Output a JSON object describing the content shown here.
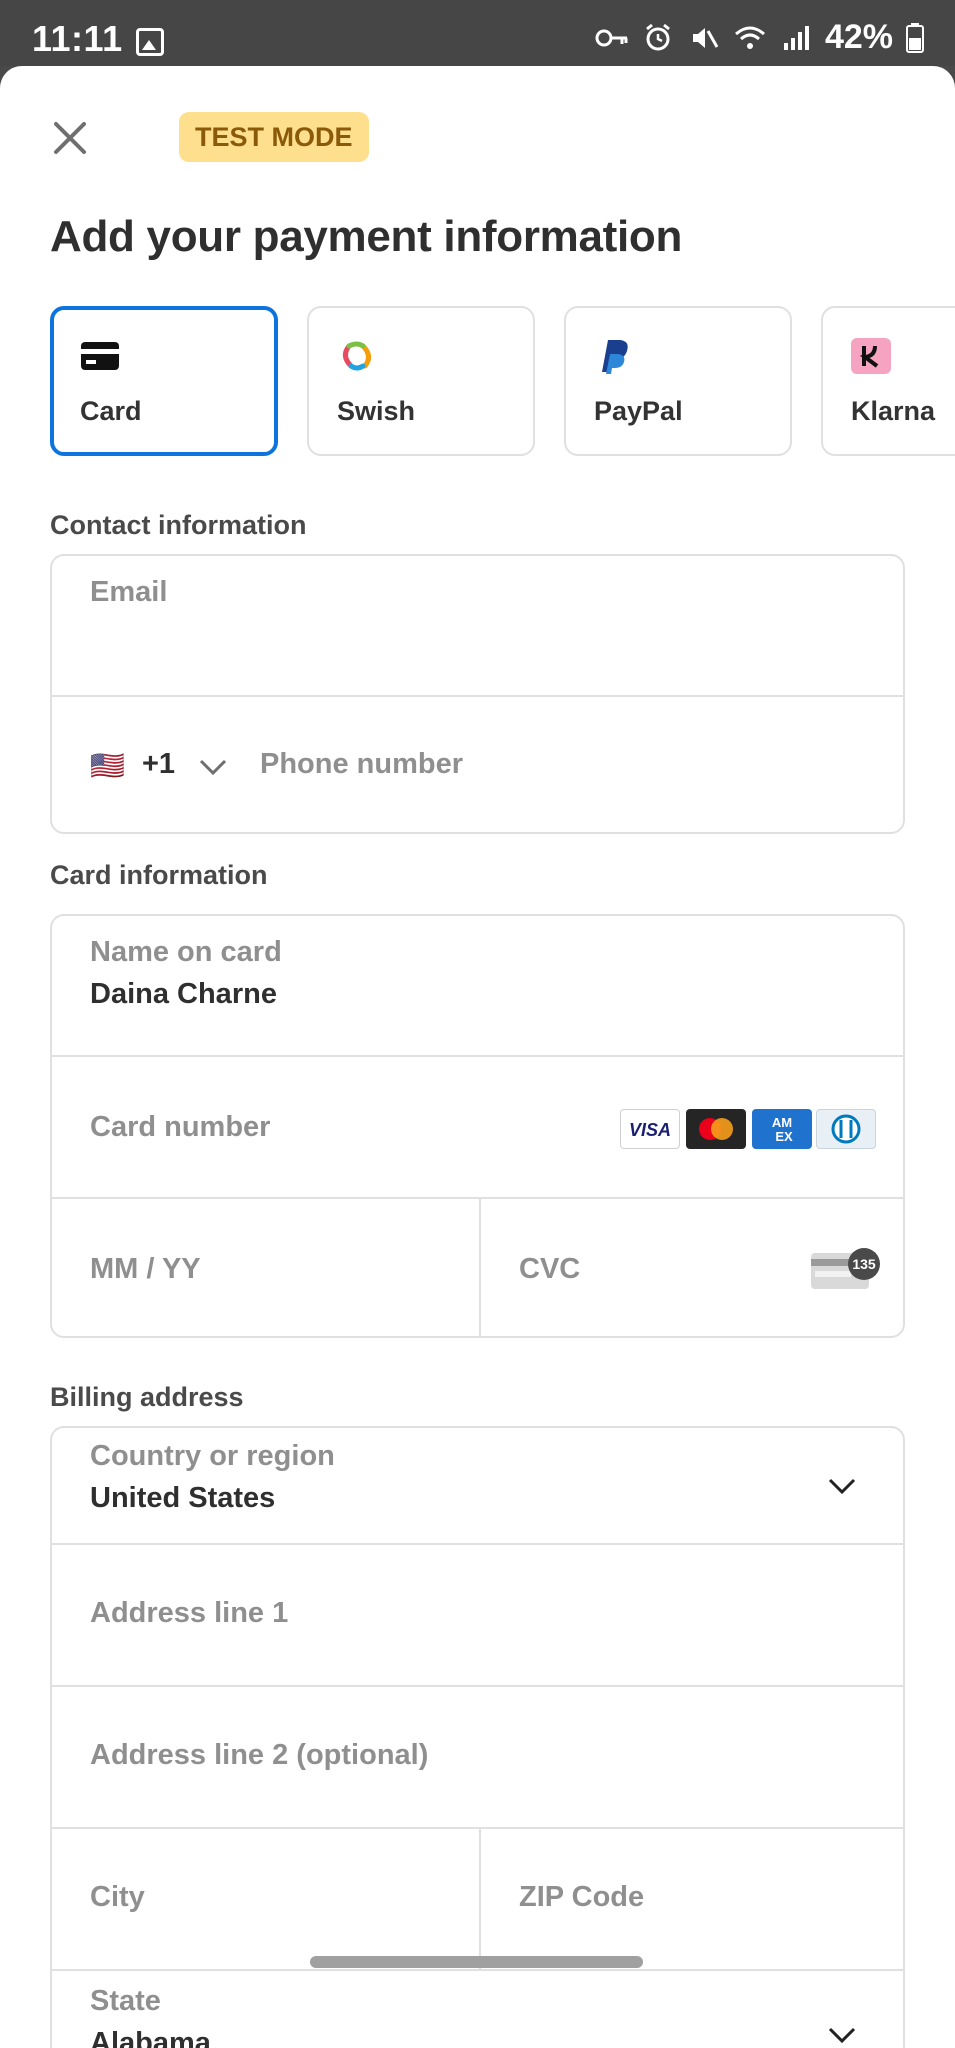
{
  "status_bar": {
    "time": "11:11",
    "battery": "42%"
  },
  "header": {
    "badge": "TEST MODE",
    "title": "Add your payment information"
  },
  "payment_methods": [
    {
      "label": "Card",
      "icon": "card-icon",
      "selected": true
    },
    {
      "label": "Swish",
      "icon": "swish-icon",
      "selected": false
    },
    {
      "label": "PayPal",
      "icon": "paypal-icon",
      "selected": false
    },
    {
      "label": "Klarna",
      "icon": "klarna-icon",
      "selected": false
    }
  ],
  "contact": {
    "section_label": "Contact information",
    "email_placeholder": "Email",
    "phone_flag": "🇺🇸",
    "phone_code": "+1",
    "phone_placeholder": "Phone number"
  },
  "card": {
    "section_label": "Card information",
    "name_label": "Name on card",
    "name_value": "Daina Charne",
    "number_placeholder": "Card number",
    "brands": [
      "VISA",
      "Mastercard",
      "AMEX",
      "Diners"
    ],
    "expiry_placeholder": "MM / YY",
    "cvc_placeholder": "CVC",
    "cvc_hint": "135"
  },
  "billing": {
    "section_label": "Billing address",
    "country_label": "Country or region",
    "country_value": "United States",
    "address1_placeholder": "Address line 1",
    "address2_placeholder": "Address line 2 (optional)",
    "city_placeholder": "City",
    "zip_placeholder": "ZIP Code",
    "state_label": "State",
    "state_value": "Alabama"
  },
  "colors": {
    "accent": "#0d74de",
    "badge_bg": "#fddf8e",
    "badge_text": "#8a5a08"
  }
}
